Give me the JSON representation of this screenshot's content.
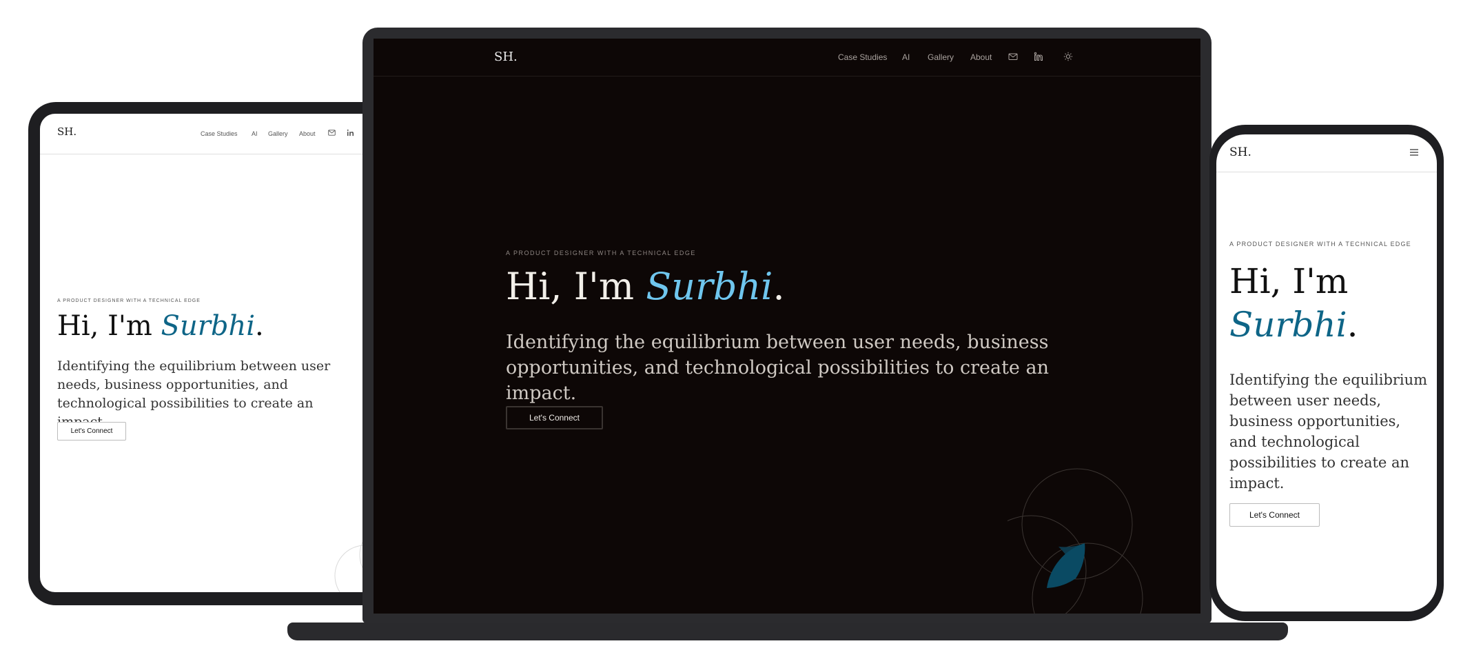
{
  "tablet": {
    "logo": "SH.",
    "nav": [
      "Case Studies",
      "AI",
      "Gallery",
      "About"
    ],
    "kicker": "A PRODUCT DESIGNER WITH A TECHNICAL EDGE",
    "title_prefix": "Hi, I'm ",
    "title_name": "Surbhi",
    "title_suffix": ".",
    "body": "Identifying the equilibrium between user needs, business opportunities, and technological possibilities to create an impact.",
    "cta": "Let's Connect",
    "icons": [
      "mail-icon",
      "linkedin-icon"
    ]
  },
  "laptop": {
    "logo": "SH.",
    "nav": [
      "Case Studies",
      "AI",
      "Gallery",
      "About"
    ],
    "kicker": "A PRODUCT DESIGNER WITH A TECHNICAL EDGE",
    "title_prefix": "Hi, I'm ",
    "title_name": "Surbhi",
    "title_suffix": ".",
    "body": "Identifying the equilibrium between user needs, business opportunities, and technological possibilities to create an impact.",
    "cta": "Let's Connect",
    "icons": [
      "mail-icon",
      "linkedin-icon",
      "sun-icon"
    ]
  },
  "phone": {
    "logo": "SH.",
    "kicker": "A PRODUCT DESIGNER WITH A TECHNICAL EDGE",
    "title_prefix": "Hi, I'm",
    "title_name": "Surbhi",
    "title_suffix": ".",
    "body": "Identifying the equilibrium between user needs, business opportunities, and technological possibilities to create an impact.",
    "cta": "Let's Connect",
    "icons": [
      "menu-icon"
    ]
  },
  "colors": {
    "dark_bg": "#0d0706",
    "accent_dark": "#6fc6ee",
    "accent_light": "#0e6587",
    "device_frame": "#1e1e21"
  }
}
